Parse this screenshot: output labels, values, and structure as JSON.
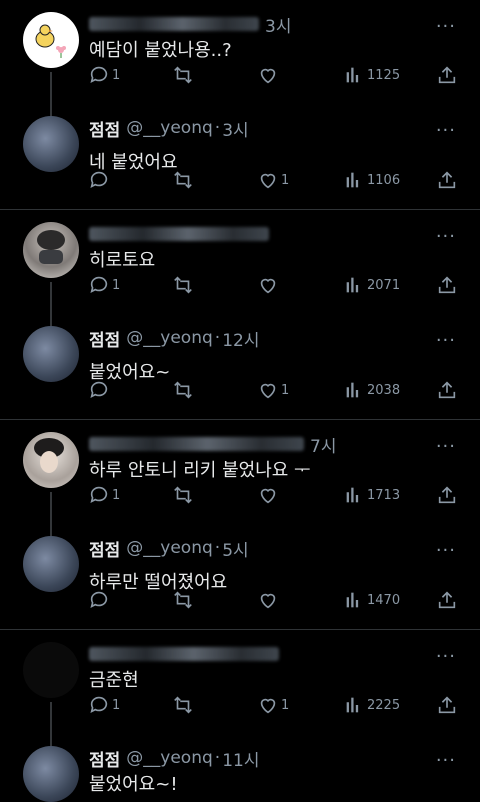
{
  "tweets": [
    {
      "handle": "",
      "time": "3시",
      "blurred_name": true,
      "text": "예담이 붙었나용..?",
      "reply": "1",
      "retweet": "",
      "like": "",
      "views": "1125",
      "avatar": "duck-avatar"
    },
    {
      "name": "점점",
      "handle": "@__yeonq",
      "time": "3시",
      "text": "네 붙었어요",
      "reply": "",
      "retweet": "",
      "like": "1",
      "views": "1106",
      "avatar": "photo-avatar"
    },
    {
      "handle": "",
      "time": "",
      "blurred_name": true,
      "text": "히로토요",
      "reply": "1",
      "retweet": "",
      "like": "",
      "views": "2071",
      "avatar": "mask-avatar"
    },
    {
      "name": "점점",
      "handle": "@__yeonq",
      "time": "12시",
      "text": "붙었어요~",
      "reply": "",
      "retweet": "",
      "like": "1",
      "views": "2038",
      "avatar": "photo-avatar"
    },
    {
      "handle": "",
      "time": "7시",
      "blurred_name": true,
      "text": "하루 안토니 리키 붙었나요 ᅮ",
      "reply": "1",
      "retweet": "",
      "like": "",
      "views": "1713",
      "avatar": "person-avatar"
    },
    {
      "name": "점점",
      "handle": "@__yeonq",
      "time": "5시",
      "text": "하루만 떨어졌어요",
      "reply": "",
      "retweet": "",
      "like": "",
      "views": "1470",
      "avatar": "photo-avatar"
    },
    {
      "handle": "",
      "time": "",
      "blurred_name": true,
      "text": "금준현",
      "reply": "1",
      "retweet": "",
      "like": "1",
      "views": "2225",
      "avatar": "dark-avatar"
    },
    {
      "name": "점점",
      "handle": "@__yeonq",
      "time": "11시",
      "text": "붙었어요~!",
      "avatar": "photo-avatar"
    }
  ],
  "sep": "·",
  "more": "···",
  "colors": {
    "bg": "#000000",
    "text": "#e7e9ea",
    "muted": "#8b98a5",
    "divider": "#2f3336"
  }
}
